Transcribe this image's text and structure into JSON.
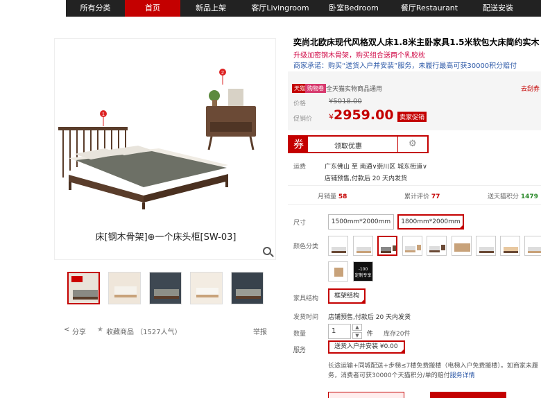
{
  "nav": {
    "items": [
      {
        "label": "所有分类"
      },
      {
        "label": "首页"
      },
      {
        "label": "新品上架"
      },
      {
        "label": "客厅Livingroom"
      },
      {
        "label": "卧室Bedroom"
      },
      {
        "label": "餐厅Restaurant"
      },
      {
        "label": "配送安装"
      }
    ],
    "active_index": 1,
    "colors": {
      "bar": "#222222",
      "active": "#c40000"
    }
  },
  "gallery": {
    "callout_1": "1",
    "callout_2": "2",
    "caption": "床[钢木骨架]⊕一个床头柜[SW-03]",
    "zoom_icon": "magnifier-icon",
    "thumbnails": 5,
    "selected_thumbnail": 0
  },
  "share": {
    "share_label": "分享",
    "favorite_label": "收藏商品 （1527人气）",
    "report_label": "举报"
  },
  "product": {
    "title": "奕尚北欧床现代风格双人床1.8米主卧家具1.5米软包大床简约实木",
    "subtitle": "升级加密钢木骨架，购买组合送两个乳胶枕",
    "promise": "商家承诺：购买“送货入户并安装”服务，未履行最高可获30000积分赔付"
  },
  "price": {
    "tmall_tag": "天猫",
    "shop_tag": "购物卷",
    "all_category": "全天猫实物商品通用",
    "coupon_link": "去刮券",
    "price_label": "价格",
    "original_price": "¥5018.00",
    "promo_label": "促销价",
    "currency": "¥",
    "promo_price": "2959.00",
    "promo_badge": "卖家促销"
  },
  "coupon": {
    "icon_text": "券",
    "get_label": "领取优惠",
    "gear_icon": "gear-icon"
  },
  "shipping": {
    "label": "运费",
    "route": "广东佛山  至 南通∨崇川区  城东街道∨",
    "presale": "店铺预售,付款后 20 天内发货"
  },
  "stats": {
    "monthly_sales_label": "月销量",
    "monthly_sales": "58",
    "reviews_label": "累计评价",
    "reviews": "77",
    "points_label": "送天猫积分",
    "points": "1479"
  },
  "options": {
    "size_label": "尺寸",
    "sizes": [
      "1500mm*2000mm",
      "1800mm*2000mm"
    ],
    "selected_size": 1,
    "color_label": "颜色分类",
    "color_swatches": 11,
    "selected_color": 2,
    "extra_swatch_text": "-100\n定制专享",
    "structure_label": "家具结构",
    "structure_value": "框架结构",
    "ship_time_label": "发货时间",
    "ship_time": "店铺预售,付款后 20 天内发货",
    "qty_label": "数量",
    "qty_value": "1",
    "qty_unit": "件",
    "stock": "库存20件",
    "service_label": "服务",
    "service_value": "送货入户并安装  ¥0.00",
    "service_desc_1": "长途运输+同城配送+步梯≤7楼免费搬楼（电梯入户免费搬楼）。如商家未履",
    "service_desc_2": "务，消费者可获30000个天猫积分/单的赔付",
    "service_detail_link": "服务详情"
  }
}
